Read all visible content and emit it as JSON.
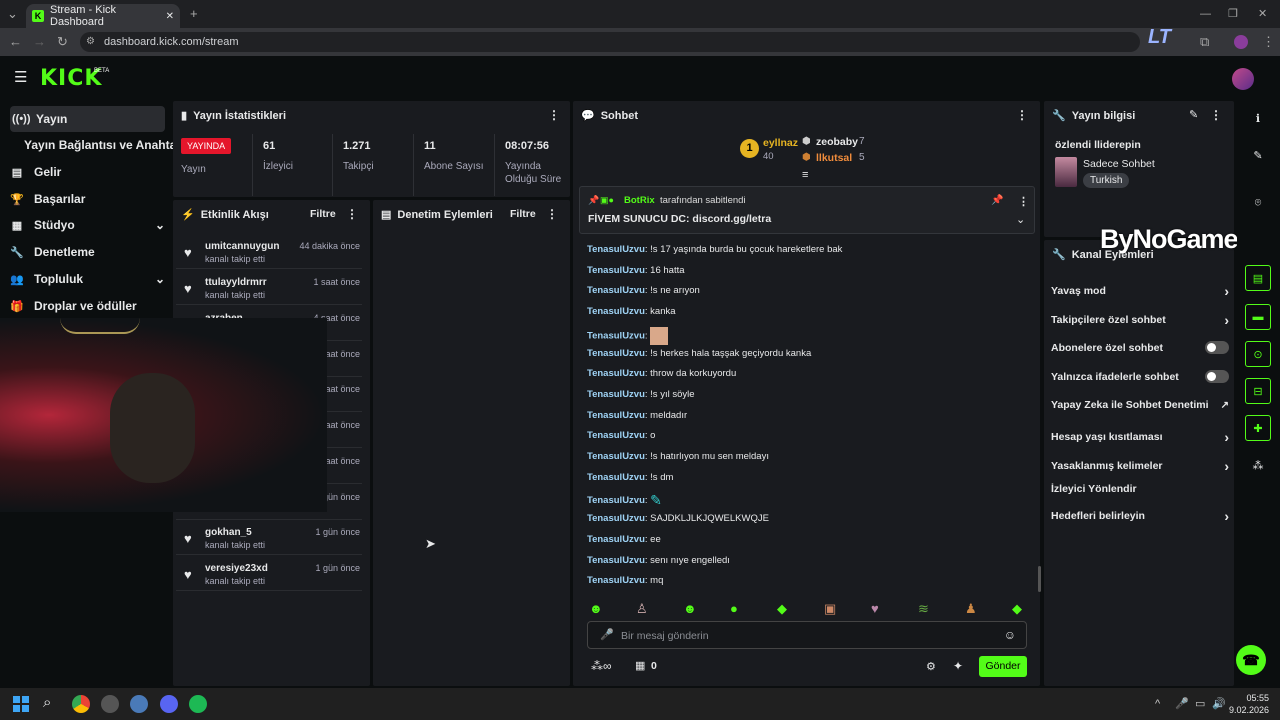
{
  "browser": {
    "tab_title": "Stream - Kick Dashboard",
    "url": "dashboard.kick.com/stream"
  },
  "header": {
    "logo": "KICK",
    "beta": "BETA"
  },
  "sidebar": {
    "items": [
      {
        "label": "Yayın",
        "icon": "broadcast-icon"
      },
      {
        "label": "Yayın Bağlantısı ve Anahtarı",
        "icon": ""
      },
      {
        "label": "Gelir",
        "icon": "revenue-icon"
      },
      {
        "label": "Başarılar",
        "icon": "trophy-icon"
      },
      {
        "label": "Stüdyo",
        "icon": "studio-icon"
      },
      {
        "label": "Denetleme",
        "icon": "wrench-icon"
      },
      {
        "label": "Topluluk",
        "icon": "community-icon"
      },
      {
        "label": "Droplar ve ödüller",
        "icon": "gift-icon"
      }
    ]
  },
  "stats": {
    "title": "Yayın İstatistikleri",
    "live_badge": "YAYINDA",
    "live_label": "Yayın",
    "viewers": {
      "value": "61",
      "label": "İzleyici"
    },
    "followers": {
      "value": "1.271",
      "label": "Takipçi"
    },
    "subs": {
      "value": "11",
      "label": "Abone Sayısı"
    },
    "uptime": {
      "value": "08:07:56",
      "label": "Yayında Olduğu Süre"
    }
  },
  "activity": {
    "title": "Etkinlik Akışı",
    "filter": "Filtre",
    "items": [
      {
        "name": "umitcannuygun",
        "sub": "kanalı takip etti",
        "time": "44 dakika önce"
      },
      {
        "name": "ttulayyldrmrr",
        "sub": "kanalı takip etti",
        "time": "1 saat önce"
      },
      {
        "name": "azraben",
        "sub": "",
        "time": "4 saat önce"
      },
      {
        "name": "",
        "sub": "",
        "time": "saat önce"
      },
      {
        "name": "",
        "sub": "",
        "time": "saat önce"
      },
      {
        "name": "",
        "sub": "",
        "time": "saat önce"
      },
      {
        "name": "",
        "sub": "",
        "time": "saat önce"
      },
      {
        "name": "",
        "sub": "",
        "time": "gün önce"
      },
      {
        "name": "gokhan_5",
        "sub": "kanalı takip etti",
        "time": "1 gün önce"
      },
      {
        "name": "veresiye23xd",
        "sub": "kanalı takip etti",
        "time": "1 gün önce"
      }
    ]
  },
  "moderation": {
    "title": "Denetim Eylemleri",
    "filter": "Filtre"
  },
  "chat": {
    "title": "Sohbet",
    "leaders": [
      {
        "rank": "1",
        "name": "eyllnaz",
        "points": "40"
      },
      {
        "name": "zeobaby",
        "points": "7"
      },
      {
        "name": "llkutsal",
        "points": "5"
      }
    ],
    "pinned": {
      "by": "BotRix",
      "by_suffix": "tarafından sabitlendi",
      "text": "FİVEM SUNUCU DC: discord.gg/letra"
    },
    "messages": [
      {
        "user": "TenasulUzvu",
        "text": "!s 17 yaşında burda bu çocuk hareketlere bak"
      },
      {
        "user": "TenasulUzvu",
        "text": "16 hatta"
      },
      {
        "user": "TenasulUzvu",
        "text": "!s ne arıyon"
      },
      {
        "user": "TenasulUzvu",
        "text": "kanka"
      },
      {
        "user": "TenasulUzvu",
        "text": ""
      },
      {
        "user": "TenasulUzvu",
        "text": "!s herkes hala taşşak geçiyordu kanka"
      },
      {
        "user": "TenasulUzvu",
        "text": "throw da korkuyordu"
      },
      {
        "user": "TenasulUzvu",
        "text": "!s yıl söyle"
      },
      {
        "user": "TenasulUzvu",
        "text": "meldadır"
      },
      {
        "user": "TenasulUzvu",
        "text": "o"
      },
      {
        "user": "TenasulUzvu",
        "text": "!s hatırlıyon mu sen meldayı"
      },
      {
        "user": "TenasulUzvu",
        "text": "!s dm"
      },
      {
        "user": "TenasulUzvu",
        "text": ""
      },
      {
        "user": "TenasulUzvu",
        "text": "SAJDKLJLKJQWELKWQJE"
      },
      {
        "user": "TenasulUzvu",
        "text": "ee"
      },
      {
        "user": "TenasulUzvu",
        "text": "senı nıye engelledı"
      },
      {
        "user": "TenasulUzvu",
        "text": "mq"
      }
    ],
    "input_placeholder": "Bir mesaj gönderin",
    "points": "0",
    "send": "Gönder"
  },
  "info": {
    "title": "Yayın bilgisi",
    "stream_title": "özlendi lliderepin",
    "category": "Sadece Sohbet",
    "tag": "Turkish"
  },
  "channel_actions": {
    "title": "Kanal Eylemleri",
    "watermark": "ByNoGame",
    "options": [
      {
        "label": "Yavaş mod",
        "type": "arrow"
      },
      {
        "label": "Takipçilere özel sohbet",
        "type": "arrow"
      },
      {
        "label": "Abonelere özel sohbet",
        "type": "toggle"
      },
      {
        "label": "Yalnızca ifadelerle sohbet",
        "type": "toggle"
      },
      {
        "label": "Yapay Zeka ile Sohbet Denetimi",
        "type": "link"
      },
      {
        "label": "Hesap yaşı kısıtlaması",
        "type": "arrow"
      },
      {
        "label": "Yasaklanmış kelimeler",
        "type": "arrow"
      },
      {
        "label": "İzleyici Yönlendir",
        "type": "none"
      },
      {
        "label": "Hedefleri belirleyin",
        "type": "arrow"
      }
    ]
  },
  "taskbar": {
    "time": "05:55",
    "date": "9.02.2026"
  },
  "colors": {
    "accent": "#53fc18",
    "live": "#e5162b"
  }
}
